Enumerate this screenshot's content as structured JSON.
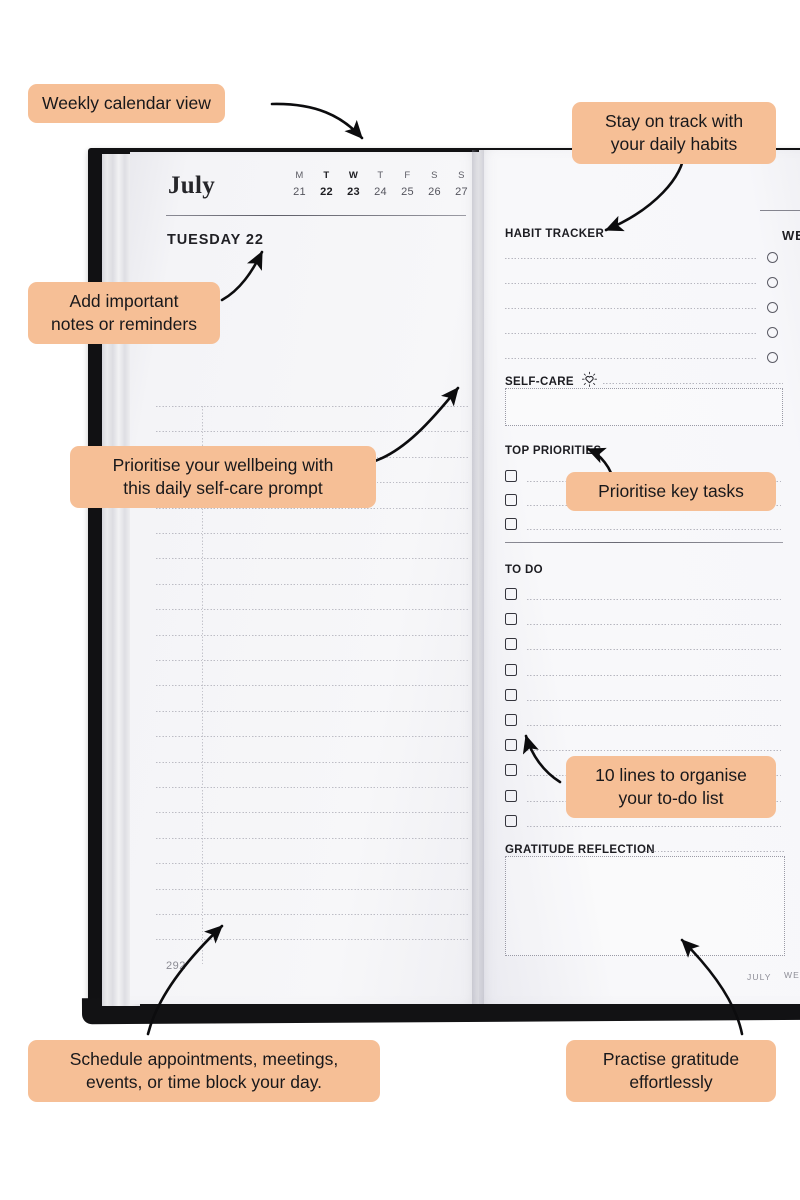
{
  "planner": {
    "month": "July",
    "page_number": "292",
    "week": {
      "day_initials": [
        "M",
        "T",
        "W",
        "T",
        "F",
        "S",
        "S"
      ],
      "day_numbers": [
        "21",
        "22",
        "23",
        "24",
        "25",
        "26",
        "27"
      ],
      "highlighted_indices": [
        1,
        2
      ]
    },
    "left_page": {
      "day_heading": "TUESDAY 22",
      "line_count": 22
    },
    "right_page": {
      "sections": {
        "habit_tracker": {
          "title": "HABIT TRACKER",
          "rows": 5
        },
        "self_care": {
          "title": "SELF-CARE",
          "icon": "sun-heart-icon"
        },
        "top_priorities": {
          "title": "TOP PRIORITIES",
          "rows": 3
        },
        "to_do": {
          "title": "TO DO",
          "rows": 10
        },
        "gratitude": {
          "title": "GRATITUDE REFLECTION"
        }
      },
      "footer_label": "JULY"
    },
    "far_right_page": {
      "day_heading": "WE",
      "footer_label": "WE"
    }
  },
  "annotations": [
    {
      "id": "weekly-calendar",
      "text": "Weekly calendar view"
    },
    {
      "id": "daily-habits",
      "text": "Stay on track with\nyour daily habits"
    },
    {
      "id": "important-notes",
      "text": "Add important\nnotes or reminders"
    },
    {
      "id": "self-care-prompt",
      "text": "Prioritise your wellbeing with\nthis daily self-care prompt"
    },
    {
      "id": "key-tasks",
      "text": "Prioritise key tasks"
    },
    {
      "id": "todo-lines",
      "text": "10 lines to organise\nyour to-do list"
    },
    {
      "id": "schedule",
      "text": "Schedule appointments, meetings,\nevents, or time block your day."
    },
    {
      "id": "gratitude",
      "text": "Practise gratitude\neffortlessly"
    }
  ],
  "colors": {
    "badge_bg": "#f6bf96",
    "badge_text": "#18181b",
    "cover": "#111113",
    "page": "#f5f5f8",
    "ink": "#1c1c21"
  }
}
